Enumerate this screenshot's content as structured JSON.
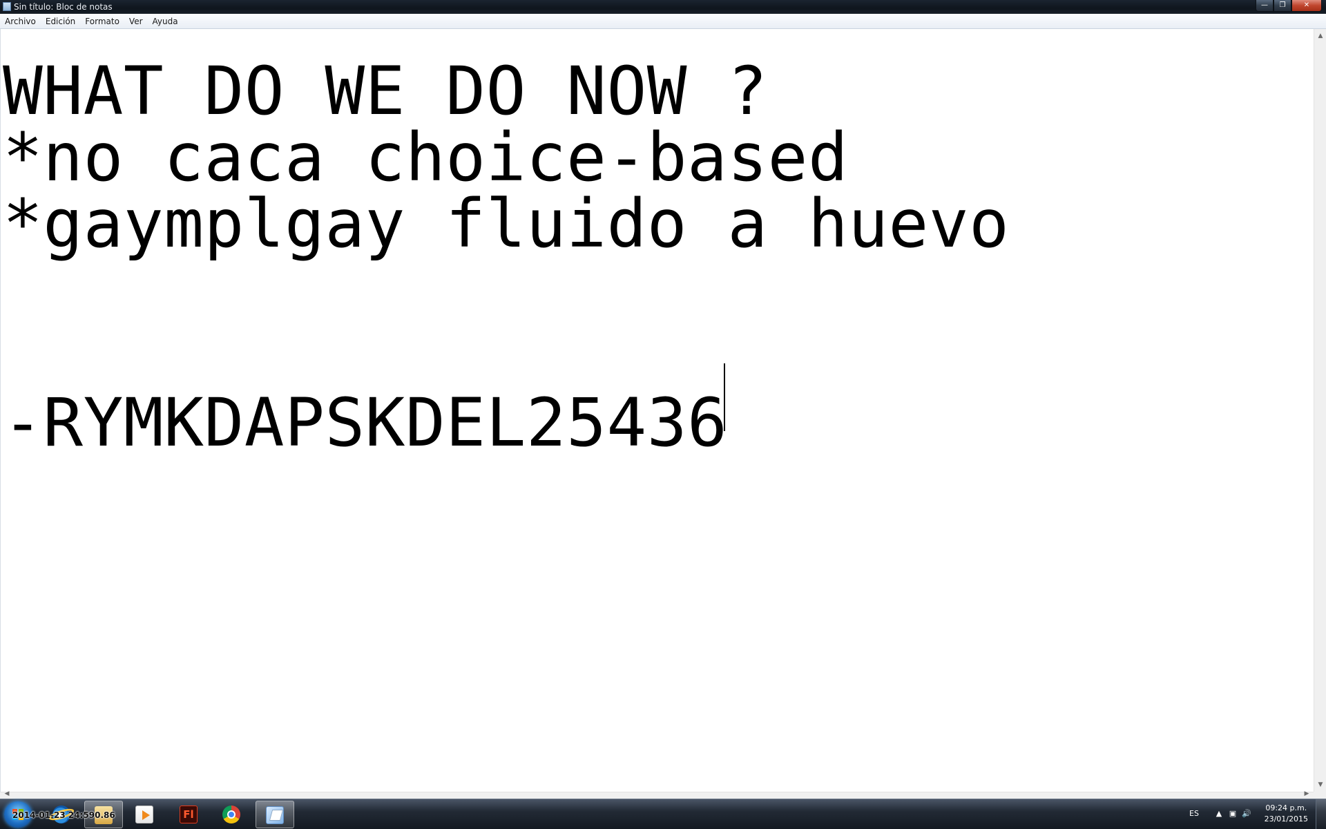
{
  "window": {
    "title": "Sin título: Bloc de notas",
    "controls": {
      "minimize": "—",
      "maximize": "❐",
      "close": "✕"
    }
  },
  "menubar": {
    "items": [
      "Archivo",
      "Edición",
      "Formato",
      "Ver",
      "Ayuda"
    ]
  },
  "editor": {
    "lines": [
      "WHAT DO WE DO NOW ?",
      "*no caca choice-based",
      "*gaymplgay fluido a huevo",
      "",
      "",
      "-RYMKDAPSKDEL25436"
    ]
  },
  "taskbar": {
    "overlay_text": "2014-01-23 24:590.86",
    "apps": [
      {
        "icon": "internet-explorer-icon"
      },
      {
        "icon": "explorer-folder-icon"
      },
      {
        "icon": "media-player-icon"
      },
      {
        "icon": "flash-icon",
        "label": "Fl"
      },
      {
        "icon": "chrome-icon"
      },
      {
        "icon": "notepad-icon"
      }
    ],
    "tray": {
      "language": "ES",
      "time": "09:24 p.m.",
      "date": "23/01/2015"
    }
  },
  "colors": {
    "titlebar": "#161d27",
    "menubar": "#eef2f7",
    "editor_bg": "#ffffff",
    "text": "#000000",
    "taskbar": "#1f2731"
  }
}
